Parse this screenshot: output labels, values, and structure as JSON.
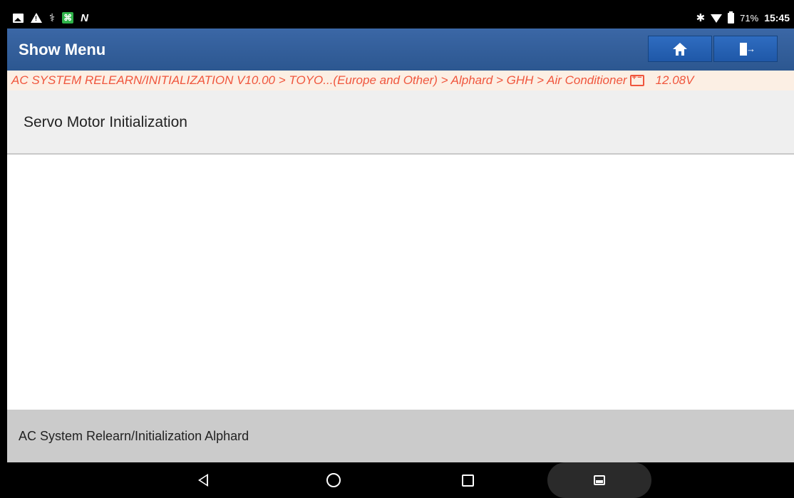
{
  "statusbar": {
    "left_icons": [
      "image-icon",
      "warning-icon",
      "stethoscope-icon",
      "app-icon",
      "n-icon"
    ],
    "right_icons": [
      "bluetooth-icon",
      "wifi-icon",
      "battery-icon"
    ],
    "battery_pct": "71%",
    "time": "15:45"
  },
  "titlebar": {
    "title": "Show Menu",
    "home_icon": "home-icon",
    "exit_icon": "exit-icon"
  },
  "breadcrumb": {
    "path": "AC SYSTEM RELEARN/INITIALIZATION V10.00 > TOYO...(Europe and Other) > Alphard > GHH > Air Conditioner",
    "battery_icon": "car-battery-icon",
    "voltage": "12.08V",
    "color": "#f0563d"
  },
  "menu": {
    "items": [
      {
        "label": "Servo Motor Initialization"
      }
    ]
  },
  "footer": {
    "label": "AC System Relearn/Initialization Alphard"
  },
  "navbar": {
    "buttons": [
      "back-icon",
      "home-circle-icon",
      "recent-apps-icon",
      "gallery-icon"
    ]
  },
  "colors": {
    "titlebar": "#2c5790",
    "button": "#2764b4",
    "breadcrumb_bg": "#fcefe4",
    "menu_bg": "#efefef",
    "footer_bg": "#cbcbcb"
  }
}
